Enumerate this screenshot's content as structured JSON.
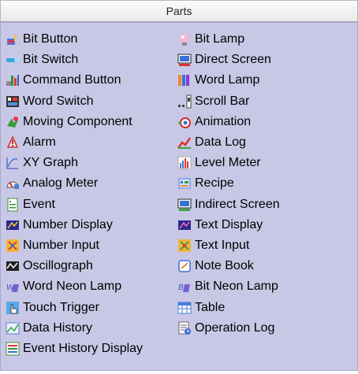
{
  "title": "Parts",
  "left": [
    {
      "label": "Bit Button",
      "icon": "bit-button-icon"
    },
    {
      "label": "Bit Switch",
      "icon": "bit-switch-icon"
    },
    {
      "label": "Command Button",
      "icon": "command-button-icon"
    },
    {
      "label": "Word Switch",
      "icon": "word-switch-icon"
    },
    {
      "label": "Moving Component",
      "icon": "moving-component-icon"
    },
    {
      "label": "Alarm",
      "icon": "alarm-icon"
    },
    {
      "label": "XY Graph",
      "icon": "xy-graph-icon"
    },
    {
      "label": "Analog Meter",
      "icon": "analog-meter-icon"
    },
    {
      "label": "Event",
      "icon": "event-icon"
    },
    {
      "label": "Number Display",
      "icon": "number-display-icon"
    },
    {
      "label": "Number Input",
      "icon": "number-input-icon"
    },
    {
      "label": "Oscillograph",
      "icon": "oscillograph-icon"
    },
    {
      "label": "Word Neon Lamp",
      "icon": "word-neon-lamp-icon"
    },
    {
      "label": "Touch Trigger",
      "icon": "touch-trigger-icon"
    },
    {
      "label": "Data History",
      "icon": "data-history-icon"
    },
    {
      "label": "Event History Display",
      "icon": "event-history-display-icon"
    }
  ],
  "right": [
    {
      "label": "Bit Lamp",
      "icon": "bit-lamp-icon"
    },
    {
      "label": "Direct Screen",
      "icon": "direct-screen-icon"
    },
    {
      "label": "Word Lamp",
      "icon": "word-lamp-icon"
    },
    {
      "label": "Scroll Bar",
      "icon": "scroll-bar-icon"
    },
    {
      "label": "Animation",
      "icon": "animation-icon"
    },
    {
      "label": "Data Log",
      "icon": "data-log-icon"
    },
    {
      "label": "Level Meter",
      "icon": "level-meter-icon"
    },
    {
      "label": "Recipe",
      "icon": "recipe-icon"
    },
    {
      "label": "Indirect Screen",
      "icon": "indirect-screen-icon"
    },
    {
      "label": "Text Display",
      "icon": "text-display-icon"
    },
    {
      "label": "Text Input",
      "icon": "text-input-icon"
    },
    {
      "label": "Note Book",
      "icon": "note-book-icon"
    },
    {
      "label": "Bit Neon Lamp",
      "icon": "bit-neon-lamp-icon"
    },
    {
      "label": "Table",
      "icon": "table-icon"
    },
    {
      "label": "Operation Log",
      "icon": "operation-log-icon"
    }
  ]
}
